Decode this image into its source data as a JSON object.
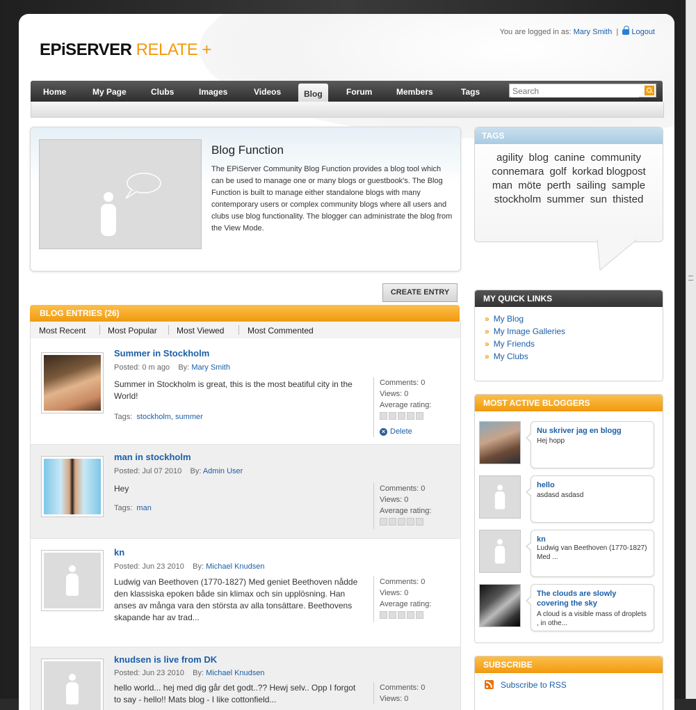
{
  "header": {
    "logo_main": "EPiSERVER",
    "logo_accent": "RELATE +",
    "login_prefix": "You are logged in as:",
    "user_name": "Mary Smith",
    "logout_label": "Logout"
  },
  "nav": {
    "items": [
      "Home",
      "My Page",
      "Clubs",
      "Images",
      "Videos",
      "Blog",
      "Forum",
      "Members",
      "Tags"
    ],
    "active": "Blog",
    "search_placeholder": "Search"
  },
  "intro": {
    "title": "Blog Function",
    "text": "The EPiServer Community Blog Function provides a blog tool which can be used to manage one or many blogs or guestbook's. The Blog Function is built to manage either standalone blogs with many contemporary users or complex community blogs where all users and clubs use blog functionality. The blogger can administrate the blog from the View Mode."
  },
  "create_entry_label": "CREATE ENTRY",
  "entries": {
    "heading": "BLOG ENTRIES (26)",
    "tabs": [
      "Most Recent",
      "Most Popular",
      "Most Viewed",
      "Most Commented"
    ],
    "items": [
      {
        "title": "Summer in Stockholm",
        "posted": "Posted: 0 m ago",
        "by_label": "By:",
        "author": "Mary Smith",
        "body": "Summer in Stockholm is great, this is the most beatiful city in the World!",
        "tags_label": "Tags:",
        "tags": "stockholm, summer",
        "comments": "Comments: 0",
        "views": "Views: 0",
        "rating_label": "Average rating:",
        "delete_label": "Delete"
      },
      {
        "title": "man in stockholm",
        "posted": "Posted: Jul 07 2010",
        "by_label": "By:",
        "author": "Admin User",
        "body": "Hey",
        "tags_label": "Tags:",
        "tags": "man",
        "comments": "Comments: 0",
        "views": "Views: 0",
        "rating_label": "Average rating:"
      },
      {
        "title": "kn",
        "posted": "Posted: Jun 23 2010",
        "by_label": "By:",
        "author": "Michael Knudsen",
        "body": "Ludwig van Beethoven (1770-1827)  Med geniet Beethoven nådde den klassiska epoken både sin klimax och sin upplösning. Han anses av många vara den största av alla tonsättare. Beethovens skapande har av trad...",
        "comments": "Comments: 0",
        "views": "Views: 0",
        "rating_label": "Average rating:"
      },
      {
        "title": "knudsen is live from DK",
        "posted": "Posted: Jun 23 2010",
        "by_label": "By:",
        "author": "Michael Knudsen",
        "body": "hello world...  hej med dig går det godt..??  Hewj selv..   Opp I forgot to say - hello!!  Mats blog - I like cottonfield...",
        "comments": "Comments: 0",
        "views": "Views: 0"
      }
    ]
  },
  "tags_box": {
    "heading": "TAGS",
    "tags": [
      "agility",
      "blog",
      "canine",
      "community",
      "connemara",
      "golf",
      "korkad blogpost",
      "man",
      "möte",
      "perth",
      "sailing",
      "sample",
      "stockholm",
      "summer",
      "sun",
      "thisted"
    ]
  },
  "quick_links": {
    "heading": "MY QUICK LINKS",
    "items": [
      "My Blog",
      "My Image Galleries",
      "My Friends",
      "My Clubs"
    ]
  },
  "active_bloggers": {
    "heading": "MOST ACTIVE BLOGGERS",
    "items": [
      {
        "title": "Nu skriver jag en blogg",
        "text": "Hej hopp"
      },
      {
        "title": "hello",
        "text": "asdasd asdasd"
      },
      {
        "title": "kn",
        "text": "Ludwig van Beethoven (1770-1827)  Med ..."
      },
      {
        "title": "The clouds are slowly covering the sky",
        "text": "A cloud is a visible mass of droplets , in othe..."
      }
    ]
  },
  "subscribe": {
    "heading": "SUBSCRIBE",
    "rss_label": "Subscribe to RSS"
  },
  "colors": {
    "accent_orange": "#f29a0e",
    "link_blue": "#1b5fa8",
    "nav_dark": "#333333"
  }
}
